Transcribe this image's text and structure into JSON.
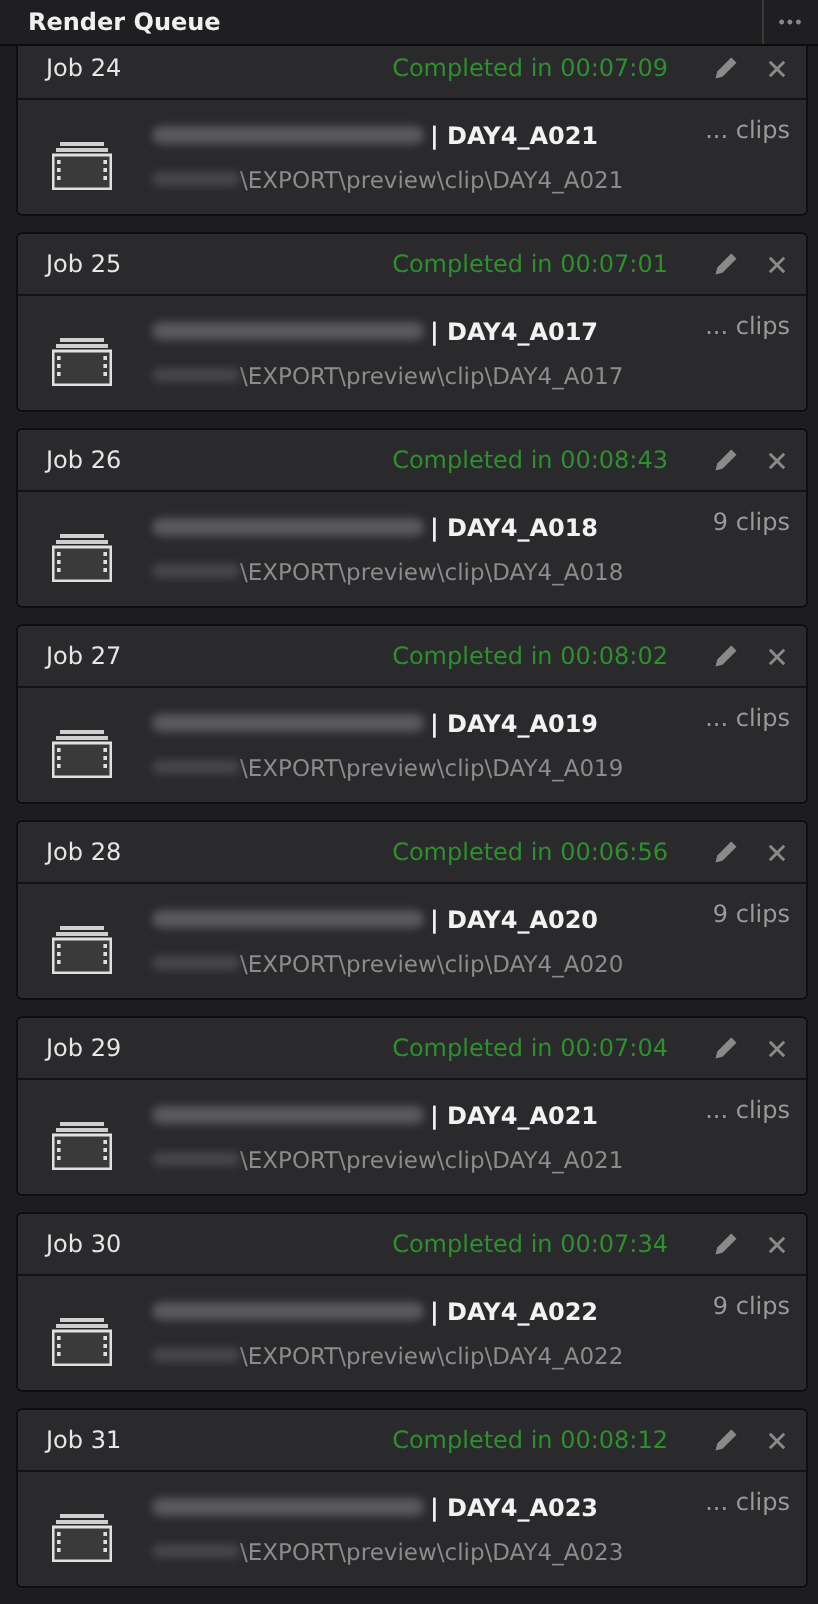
{
  "panel": {
    "title": "Render Queue",
    "menu": "•••"
  },
  "jobs": [
    {
      "label": "Job 24",
      "status": "Completed in 00:07:09",
      "title": "| DAY4_A021",
      "clips": "... clips",
      "path": "\\EXPORT\\preview\\clip\\DAY4_A021"
    },
    {
      "label": "Job 25",
      "status": "Completed in 00:07:01",
      "title": "| DAY4_A017",
      "clips": "... clips",
      "path": "\\EXPORT\\preview\\clip\\DAY4_A017"
    },
    {
      "label": "Job 26",
      "status": "Completed in 00:08:43",
      "title": "| DAY4_A018",
      "clips": "9 clips",
      "path": "\\EXPORT\\preview\\clip\\DAY4_A018"
    },
    {
      "label": "Job 27",
      "status": "Completed in 00:08:02",
      "title": "| DAY4_A019",
      "clips": "... clips",
      "path": "\\EXPORT\\preview\\clip\\DAY4_A019"
    },
    {
      "label": "Job 28",
      "status": "Completed in 00:06:56",
      "title": "| DAY4_A020",
      "clips": "9 clips",
      "path": "\\EXPORT\\preview\\clip\\DAY4_A020"
    },
    {
      "label": "Job 29",
      "status": "Completed in 00:07:04",
      "title": "| DAY4_A021",
      "clips": "... clips",
      "path": "\\EXPORT\\preview\\clip\\DAY4_A021"
    },
    {
      "label": "Job 30",
      "status": "Completed in 00:07:34",
      "title": "| DAY4_A022",
      "clips": "9 clips",
      "path": "\\EXPORT\\preview\\clip\\DAY4_A022"
    },
    {
      "label": "Job 31",
      "status": "Completed in 00:08:12",
      "title": "| DAY4_A023",
      "clips": "... clips",
      "path": "\\EXPORT\\preview\\clip\\DAY4_A023"
    }
  ]
}
